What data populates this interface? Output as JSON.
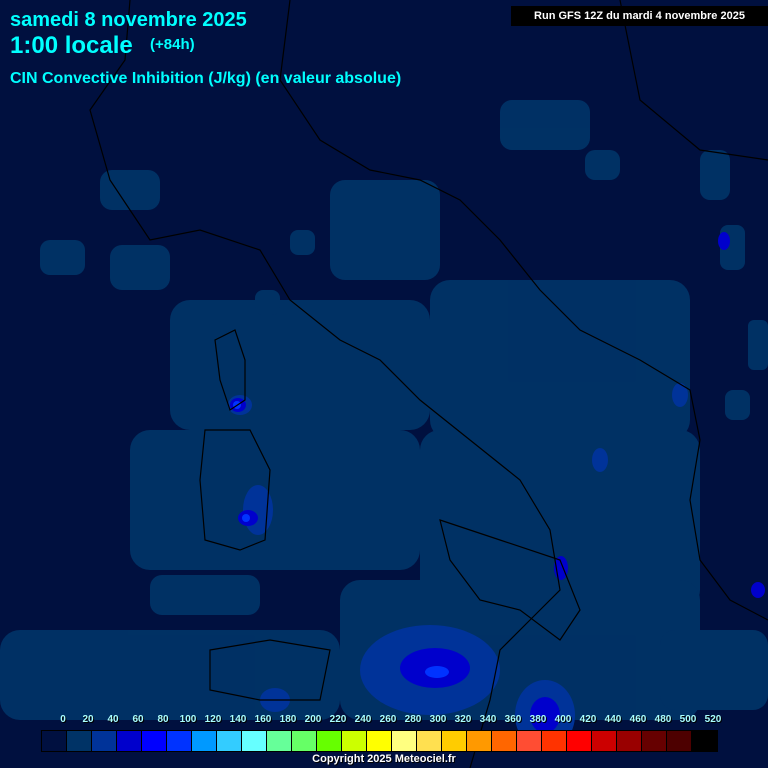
{
  "header": {
    "date": "samedi 8 novembre 2025",
    "time": "1:00 locale",
    "offset": "(+84h)",
    "parameter": "CIN Convective Inhibition (J/kg) (en valeur absolue)",
    "run": "Run GFS 12Z du mardi 4 novembre 2025"
  },
  "legend": {
    "labels": [
      "0",
      "20",
      "40",
      "60",
      "80",
      "100",
      "120",
      "140",
      "160",
      "180",
      "200",
      "220",
      "240",
      "260",
      "280",
      "300",
      "320",
      "340",
      "360",
      "380",
      "400",
      "420",
      "440",
      "460",
      "480",
      "500",
      "520"
    ],
    "colors": [
      "#001040",
      "#003366",
      "#003399",
      "#0000cc",
      "#0000ff",
      "#0033ff",
      "#0099ff",
      "#33ccff",
      "#66ffff",
      "#66ff99",
      "#66ff66",
      "#66ff00",
      "#ccff00",
      "#ffff00",
      "#ffff80",
      "#ffe050",
      "#ffcc00",
      "#ff9900",
      "#ff6600",
      "#ff4d33",
      "#ff3300",
      "#ff0000",
      "#cc0000",
      "#990000",
      "#660000",
      "#4d0000",
      "#000000"
    ]
  },
  "footer": {
    "copyright": "Copyright 2025 Meteociel.fr"
  }
}
